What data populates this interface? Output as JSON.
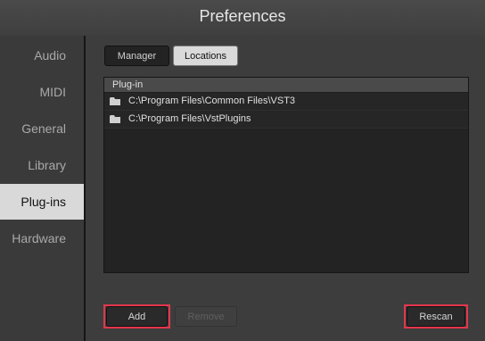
{
  "window": {
    "title": "Preferences"
  },
  "sidebar": {
    "items": [
      {
        "label": "Audio"
      },
      {
        "label": "MIDI"
      },
      {
        "label": "General"
      },
      {
        "label": "Library"
      },
      {
        "label": "Plug-ins",
        "active": true
      },
      {
        "label": "Hardware"
      }
    ]
  },
  "tabs": [
    {
      "label": "Manager"
    },
    {
      "label": "Locations",
      "active": true
    }
  ],
  "list": {
    "header": "Plug-in",
    "rows": [
      {
        "path": "C:\\Program Files\\Common Files\\VST3",
        "icon": "folder-icon"
      },
      {
        "path": "C:\\Program Files\\VstPlugins",
        "icon": "folder-icon"
      }
    ]
  },
  "buttons": {
    "add": "Add",
    "remove": "Remove",
    "rescan": "Rescan"
  },
  "colors": {
    "highlight": "#e3364c",
    "active_sidebar": "#d9d9d9"
  }
}
